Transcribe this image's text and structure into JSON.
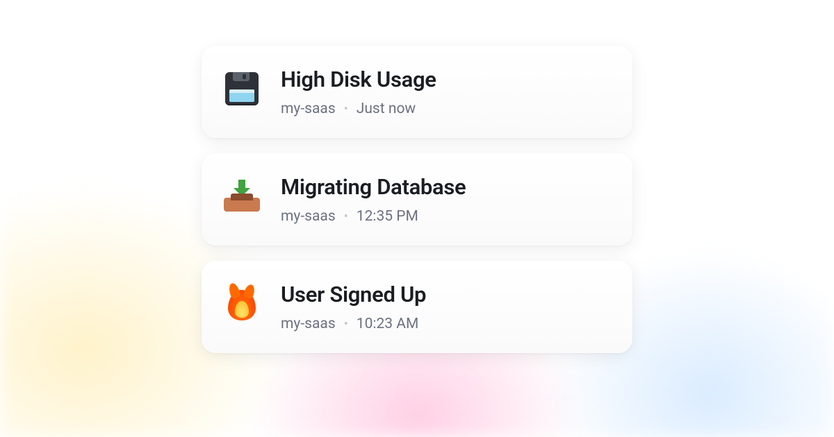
{
  "notifications": [
    {
      "icon": "floppy-disk",
      "title": "High Disk Usage",
      "project": "my-saas",
      "time": "Just now"
    },
    {
      "icon": "inbox-download",
      "title": "Migrating Database",
      "project": "my-saas",
      "time": "12:35 PM"
    },
    {
      "icon": "fire",
      "title": "User Signed Up",
      "project": "my-saas",
      "time": "10:23 AM"
    }
  ]
}
